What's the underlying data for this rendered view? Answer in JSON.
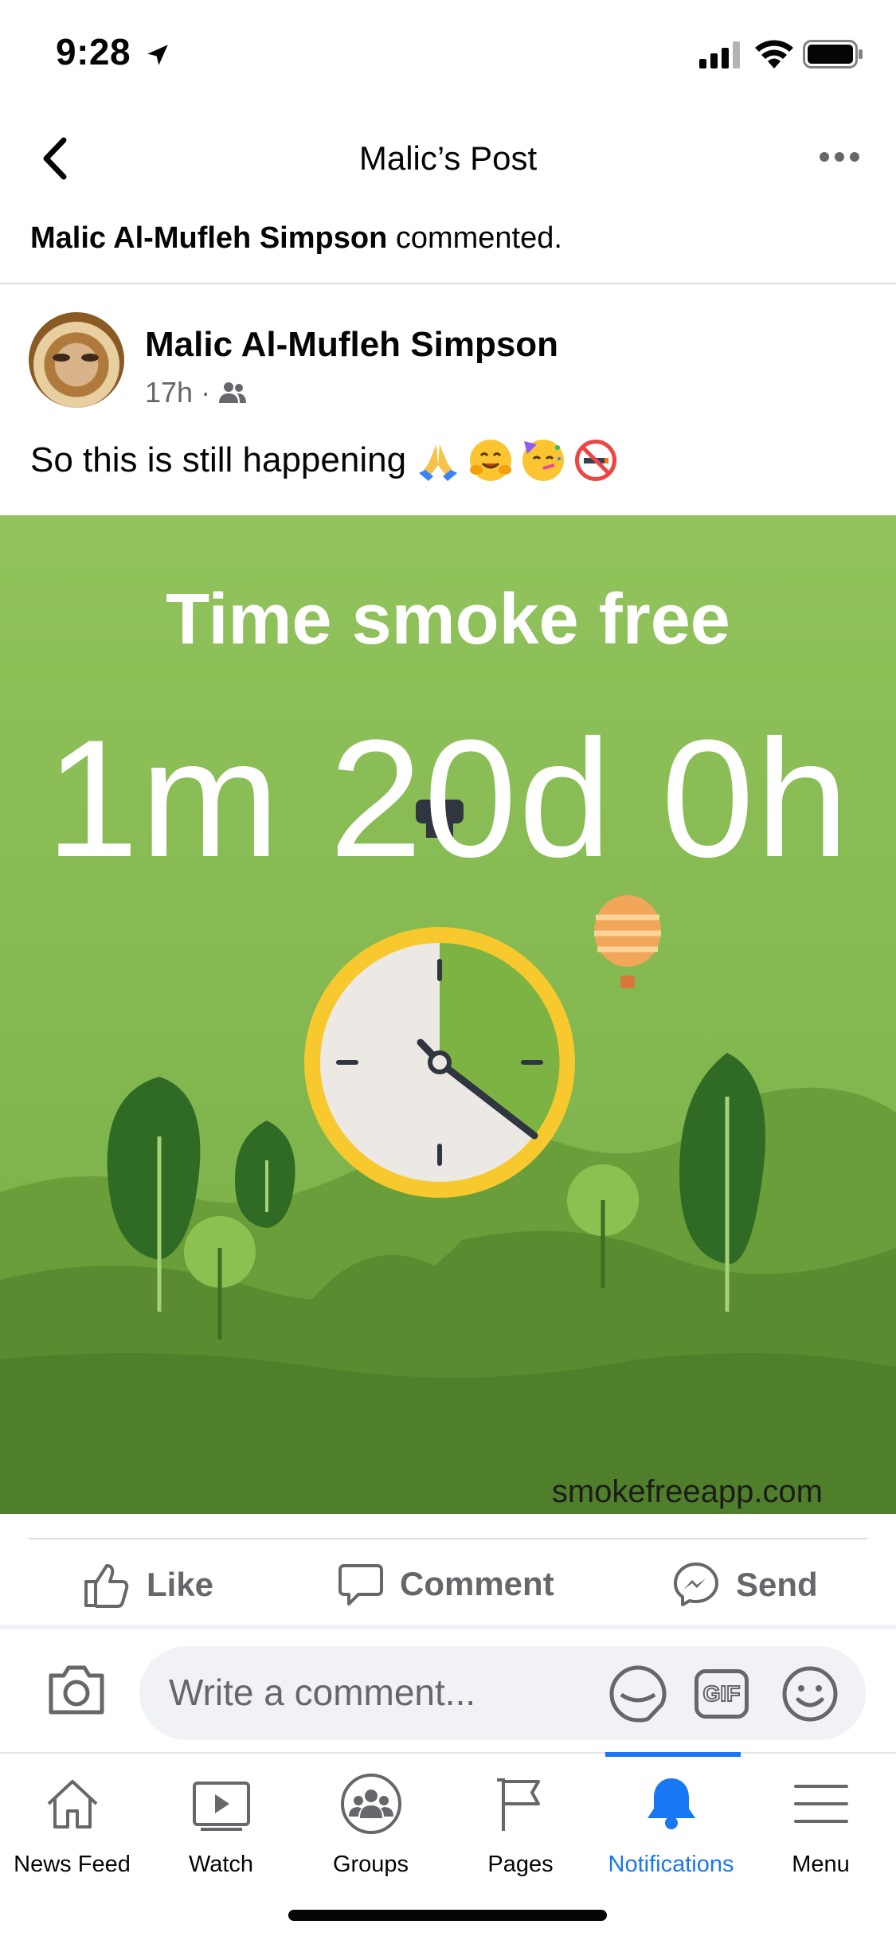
{
  "status_bar": {
    "time": "9:28"
  },
  "nav": {
    "title": "Malic’s Post"
  },
  "notification": {
    "name": "Malic Al-Mufleh Simpson",
    "action": " commented."
  },
  "post": {
    "author": "Malic Al-Mufleh Simpson",
    "time": "17h",
    "separator": "·",
    "text": "So this is still happening",
    "emojis": [
      "folded-hands",
      "hugging-face",
      "partying-face",
      "no-smoking"
    ],
    "image": {
      "title": "Time smoke free",
      "duration": "1m 20d 0h",
      "url": "smokefreeapp.com"
    }
  },
  "actions": {
    "like": "Like",
    "comment": "Comment",
    "send": "Send"
  },
  "composer": {
    "placeholder": "Write a comment...",
    "gif": "GIF"
  },
  "tabbar": {
    "items": [
      {
        "label": "News Feed",
        "icon": "home-icon"
      },
      {
        "label": "Watch",
        "icon": "video-icon"
      },
      {
        "label": "Groups",
        "icon": "groups-icon"
      },
      {
        "label": "Pages",
        "icon": "flag-icon"
      },
      {
        "label": "Notifications",
        "icon": "bell-icon",
        "active": true
      },
      {
        "label": "Menu",
        "icon": "hamburger-icon"
      }
    ]
  },
  "colors": {
    "accent": "#1877f2",
    "image_bg": "#8bbf55",
    "image_ground": "#4f7f2a"
  }
}
